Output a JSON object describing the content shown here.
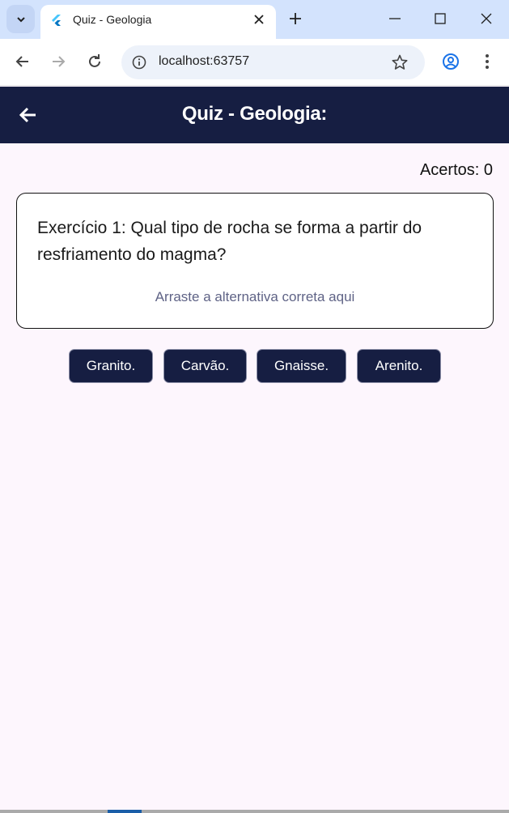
{
  "browser": {
    "tab_title": "Quiz - Geologia",
    "url": "localhost:63757"
  },
  "appbar": {
    "title": "Quiz - Geologia:"
  },
  "score": {
    "label": "Acertos: 0"
  },
  "question": {
    "text": "Exercício 1: Qual tipo de rocha se forma a partir do resfriamento do magma?",
    "drop_hint": "Arraste a alternativa correta aqui"
  },
  "options": [
    {
      "label": "Granito."
    },
    {
      "label": "Carvão."
    },
    {
      "label": "Gnaisse."
    },
    {
      "label": "Arenito."
    }
  ],
  "colors": {
    "primary": "#161e42",
    "background": "#fdf6fd",
    "hint": "#5f6386"
  }
}
